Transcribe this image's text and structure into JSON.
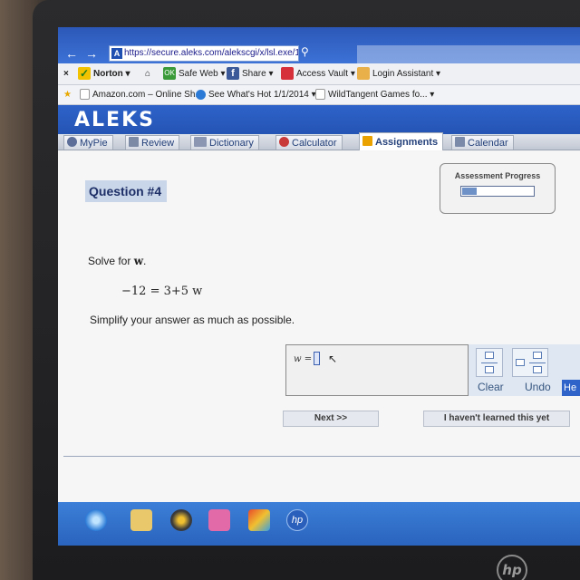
{
  "browser": {
    "url": "https://secure.aleks.com/alekscgi/x/lsl.exe/1o_u",
    "toolbar": {
      "norton": "Norton",
      "safe_web": "Safe Web",
      "share": "Share",
      "access_vault": "Access Vault",
      "login_assistant": "Login Assistant"
    },
    "favorites": [
      "Amazon.com – Online Sh...",
      "See What's Hot 1/1/2014",
      "WildTangent Games fo..."
    ]
  },
  "app": {
    "logo": "ALEKS",
    "menu": [
      {
        "label": "MyPie"
      },
      {
        "label": "Review"
      },
      {
        "label": "Dictionary"
      },
      {
        "label": "Calculator"
      },
      {
        "label": "Assignments"
      },
      {
        "label": "Calendar"
      }
    ]
  },
  "question": {
    "title": "Question #4",
    "solve_prefix": "Solve for",
    "variable": "w",
    "solve_suffix": ".",
    "equation": "−12 = 3+5 w",
    "instruction": "Simplify your answer as much as possible.",
    "answer_label": "w ="
  },
  "progress": {
    "label": "Assessment Progress",
    "fraction": 0.2
  },
  "tools": {
    "clear": "Clear",
    "undo": "Undo",
    "help": "He"
  },
  "actions": {
    "next": "Next >>",
    "not_learned": "I haven't learned this yet"
  },
  "colors": {
    "aleks_blue": "#2a5abc",
    "question_bg": "#c9d6ea",
    "progress_fill": "#6e91c8"
  },
  "device": {
    "brand": "hp"
  }
}
